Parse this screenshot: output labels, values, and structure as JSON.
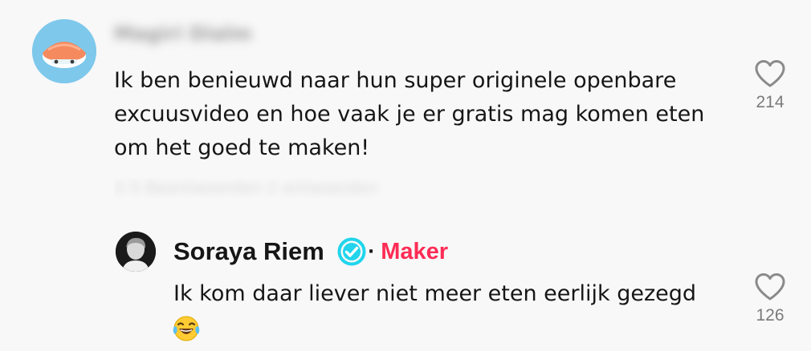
{
  "comment": {
    "author_blurred": "Magiri Dialm",
    "text": "Ik ben benieuwd naar hun super originele openbare excuusvideo en hoe vaak je er gratis mag komen eten om het goed te maken!",
    "meta_blurred": "2-5 Beantwoorden 2 antwoorden",
    "likes": "214",
    "avatar_icon": "sushi-avatar-icon"
  },
  "reply": {
    "author": "Soraya Riem",
    "separator": "·",
    "badge": "Maker",
    "text": "Ik kom daar liever niet meer eten eerlijk gezegd",
    "emoji": "face-with-tears-of-joy-icon",
    "likes": "126",
    "verified_icon": "verified-check-icon"
  },
  "colors": {
    "background": "#f8f8f8",
    "text": "#161616",
    "muted": "#7a7a7a",
    "maker": "#fe2c55",
    "verified": "#20d5ec",
    "avatar_bg": "#7ec8ec"
  }
}
